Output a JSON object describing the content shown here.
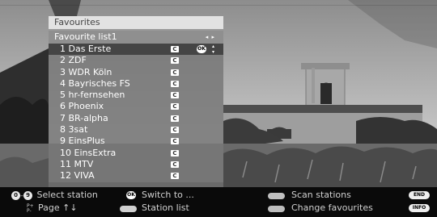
{
  "osd": {
    "title": "Favourites",
    "list_name": "Favourite list1",
    "list_arrows": "◂ ▸",
    "selected_ok": "OK",
    "channel_badge": "C",
    "channels": [
      {
        "label": "1 Das Erste"
      },
      {
        "label": "2 ZDF"
      },
      {
        "label": "3 WDR Köln"
      },
      {
        "label": "4 Bayrisches FS"
      },
      {
        "label": "5 hr-fernsehen"
      },
      {
        "label": "6 Phoenix"
      },
      {
        "label": "7 BR-alpha"
      },
      {
        "label": "8 3sat"
      },
      {
        "label": "9 EinsPlus"
      },
      {
        "label": "10 EinsExtra"
      },
      {
        "label": "11 MTV"
      },
      {
        "label": "12 VIVA"
      }
    ]
  },
  "help": {
    "digit_from": "0",
    "digit_to": "9",
    "select_station": "Select station",
    "page_plus": "P+",
    "page_minus": "P-",
    "page": "Page ↑↓",
    "ok": "OK",
    "switch_to": "Switch to ...",
    "station_list": "Station list",
    "scan_stations": "Scan stations",
    "change_favourites": "Change favourites",
    "end": "END",
    "info": "INFO",
    "colors": {
      "red": "#c0c0c0",
      "green": "#dddddd",
      "yellow": "#bbbbbb",
      "blue": "#aaaaaa"
    }
  }
}
